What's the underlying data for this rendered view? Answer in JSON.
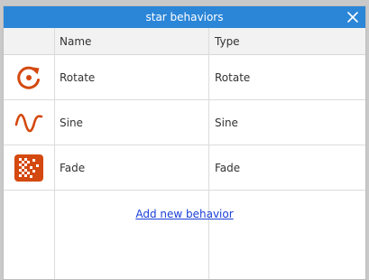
{
  "dialog": {
    "title": "star behaviors",
    "close_icon": "close-x-icon"
  },
  "table": {
    "columns": [
      "",
      "Name",
      "Type"
    ],
    "rows": [
      {
        "icon": "rotate-icon",
        "name": "Rotate",
        "type": "Rotate"
      },
      {
        "icon": "sine-wave-icon",
        "name": "Sine",
        "type": "Sine"
      },
      {
        "icon": "fade-icon",
        "name": "Fade",
        "type": "Fade"
      }
    ]
  },
  "add_behavior_label": "Add new behavior",
  "colors": {
    "titlebar": "#2b86d8",
    "icon_accent": "#d4490f",
    "link": "#1a3fd8"
  }
}
